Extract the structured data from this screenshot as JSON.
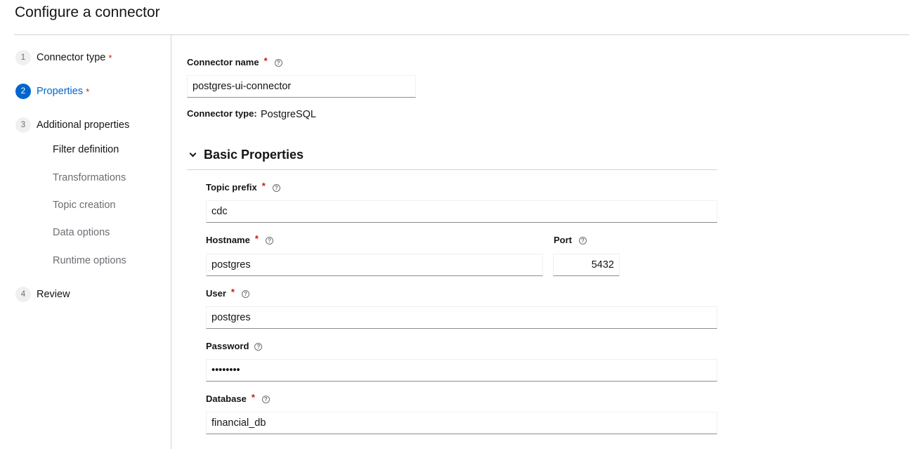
{
  "page": {
    "title": "Configure a connector"
  },
  "nav": {
    "steps": [
      {
        "num": "1",
        "label": "Connector type",
        "required": "*"
      },
      {
        "num": "2",
        "label": "Properties",
        "required": "*"
      },
      {
        "num": "3",
        "label": "Additional properties"
      },
      {
        "num": "4",
        "label": "Review"
      }
    ],
    "substeps": [
      {
        "label": "Filter definition"
      },
      {
        "label": "Transformations"
      },
      {
        "label": "Topic creation"
      },
      {
        "label": "Data options"
      },
      {
        "label": "Runtime options"
      }
    ]
  },
  "form": {
    "connector_name": {
      "label": "Connector name",
      "required": "*",
      "value": "postgres-ui-connector"
    },
    "connector_type": {
      "label": "Connector type:",
      "value": "PostgreSQL"
    },
    "section": {
      "title": "Basic Properties"
    },
    "topic_prefix": {
      "label": "Topic prefix",
      "required": "*",
      "value": "cdc"
    },
    "hostname": {
      "label": "Hostname",
      "required": "*",
      "value": "postgres"
    },
    "port": {
      "label": "Port",
      "value": "5432"
    },
    "user": {
      "label": "User",
      "required": "*",
      "value": "postgres"
    },
    "password": {
      "label": "Password",
      "value": "••••••••"
    },
    "database": {
      "label": "Database",
      "required": "*",
      "value": "financial_db"
    }
  },
  "icons": {
    "help": "help-circle-icon",
    "section": "chevron-down-icon"
  },
  "colors": {
    "accent": "#0066cc",
    "required": "#c9190b",
    "muted": "#6a6e73",
    "border": "#d2d2d2"
  }
}
